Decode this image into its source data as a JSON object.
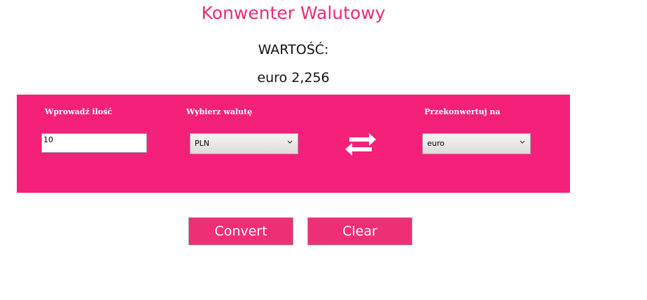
{
  "app": {
    "title": "Konwenter Walutowy"
  },
  "result": {
    "label": "WARTOŚĆ:",
    "value": "euro 2,256"
  },
  "form": {
    "amount_label": "Wprowadź ilość",
    "amount_value": "10",
    "from_label": "Wybierz walutę",
    "from_value": "PLN",
    "to_label": "Przekonwertuj na",
    "to_value": "euro"
  },
  "buttons": {
    "convert": "Convert",
    "clear": "Clear"
  },
  "colors": {
    "accent": "#f5207a",
    "title": "#ee2b74",
    "button": "#ee2f76"
  },
  "icons": {
    "swap": "swap-arrows-icon",
    "dropdown": "chevron-down-icon"
  }
}
